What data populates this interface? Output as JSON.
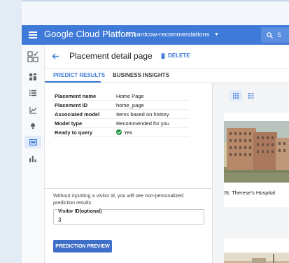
{
  "topbar": {
    "brand": "Google Cloud Platform",
    "project": "cardcow-recommendations",
    "search_label": "S"
  },
  "rail": {
    "icons": [
      "recommendations-ai-icon",
      "dashboard-icon",
      "catalog-list-icon",
      "events-chart-icon",
      "models-bulb-icon",
      "placements-icon",
      "monitoring-bar-icon"
    ],
    "active_index": 5
  },
  "header": {
    "title": "Placement detail page",
    "delete_label": "DELETE"
  },
  "tabs": [
    {
      "label": "PREDICT RESULTS",
      "active": true
    },
    {
      "label": "BUSINESS INSIGHTS",
      "active": false
    }
  ],
  "details": [
    {
      "key": "Placement name",
      "value": "Home Page"
    },
    {
      "key": "Placement ID",
      "value": "home_page"
    },
    {
      "key": "Associated model",
      "value": "Items based on history"
    },
    {
      "key": "Model type",
      "value": "Recommended for you"
    },
    {
      "key": "Ready to query",
      "value": "Yes"
    }
  ],
  "prediction": {
    "hint": "Without inputting a visitor id, you will see non-personalized prediction results.",
    "visitor_label": "Visitor ID(optional)",
    "visitor_value": "3",
    "button_label": "PREDICTION PREVIEW"
  },
  "results": {
    "items": [
      {
        "caption": "St. Therese's Hospital"
      },
      {
        "caption": ""
      }
    ]
  },
  "colors": {
    "brand_blue": "#3f7ad8",
    "button_blue": "#3f6fc6",
    "ready_green": "#1e8e3e"
  }
}
